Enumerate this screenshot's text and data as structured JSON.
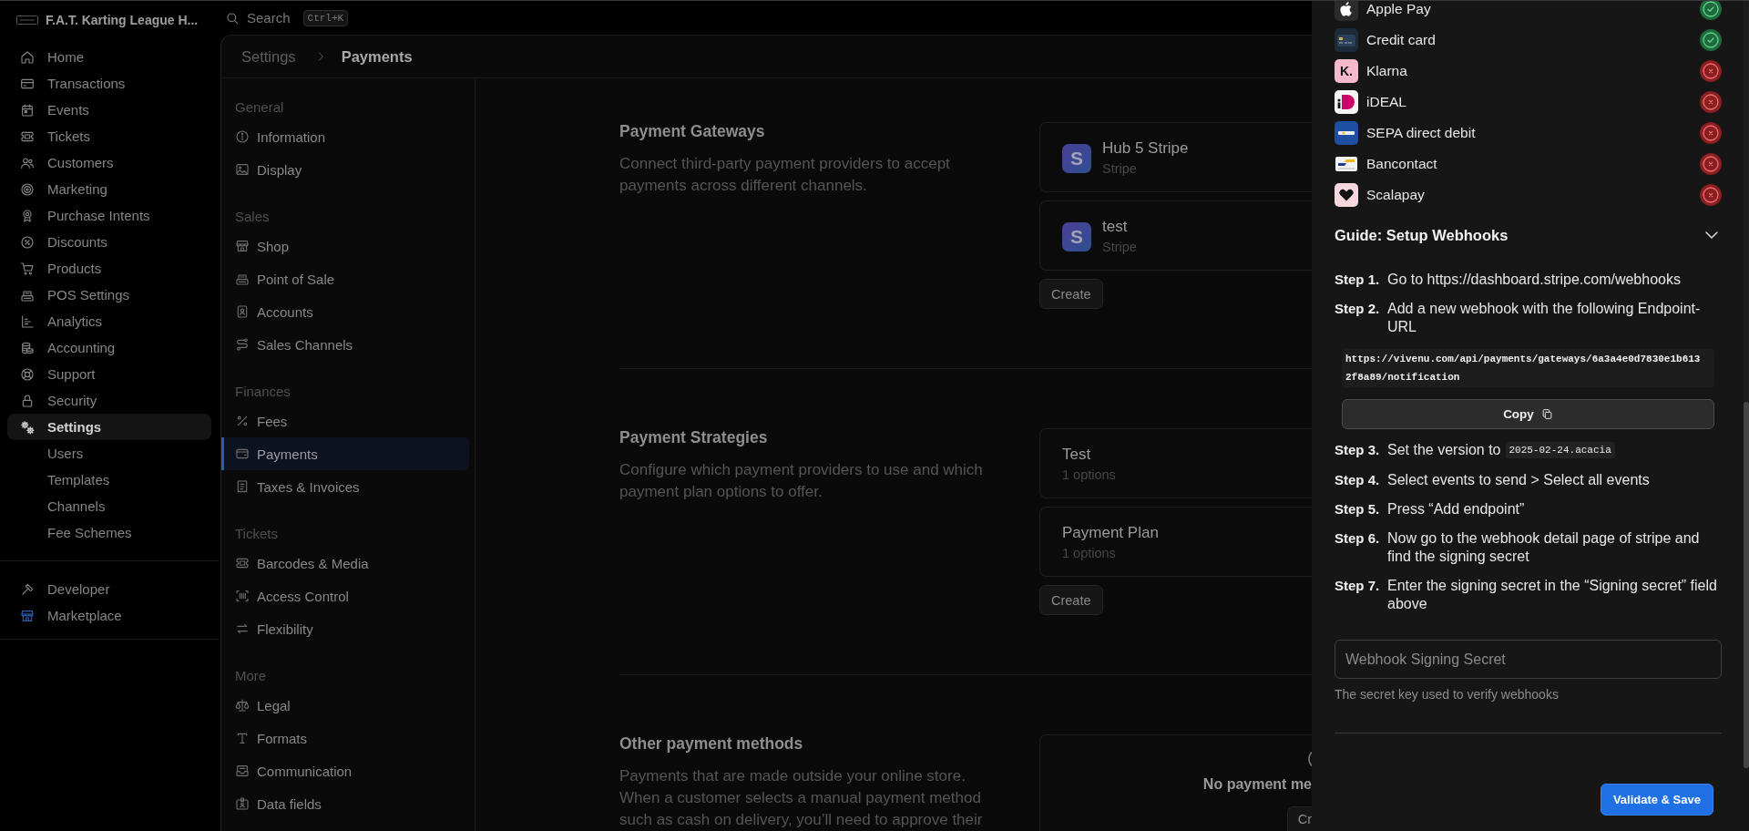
{
  "sidebar": {
    "org_name": "F.A.T. Karting League H...",
    "items": [
      {
        "label": "Home",
        "selected": false
      },
      {
        "label": "Transactions",
        "selected": false
      },
      {
        "label": "Events",
        "selected": false
      },
      {
        "label": "Tickets",
        "selected": false
      },
      {
        "label": "Customers",
        "selected": false
      },
      {
        "label": "Marketing",
        "selected": false
      },
      {
        "label": "Purchase Intents",
        "selected": false
      },
      {
        "label": "Discounts",
        "selected": false
      },
      {
        "label": "Products",
        "selected": false
      },
      {
        "label": "POS Settings",
        "selected": false
      },
      {
        "label": "Analytics",
        "selected": false
      },
      {
        "label": "Accounting",
        "selected": false
      },
      {
        "label": "Support",
        "selected": false
      },
      {
        "label": "Security",
        "selected": false
      },
      {
        "label": "Settings",
        "selected": true,
        "children": [
          {
            "label": "Users",
            "selected": false
          },
          {
            "label": "Templates",
            "selected": false
          },
          {
            "label": "Channels",
            "selected": false
          },
          {
            "label": "Fee Schemes",
            "selected": false
          }
        ]
      }
    ],
    "footer_items": [
      {
        "label": "Developer",
        "selected": false
      },
      {
        "label": "Marketplace",
        "selected": false
      }
    ]
  },
  "search": {
    "label": "Search",
    "shortcut": "Ctrl+K"
  },
  "breadcrumb": [
    "Settings",
    "Payments"
  ],
  "settings_nav": {
    "groups": [
      {
        "title": "General",
        "items": [
          {
            "label": "Information",
            "selected": false
          },
          {
            "label": "Display",
            "selected": false
          }
        ]
      },
      {
        "title": "Sales",
        "items": [
          {
            "label": "Shop",
            "selected": false
          },
          {
            "label": "Point of Sale",
            "selected": false
          },
          {
            "label": "Accounts",
            "selected": false
          },
          {
            "label": "Sales Channels",
            "selected": false
          }
        ]
      },
      {
        "title": "Finances",
        "items": [
          {
            "label": "Fees",
            "selected": false
          },
          {
            "label": "Payments",
            "selected": true
          },
          {
            "label": "Taxes & Invoices",
            "selected": false
          }
        ]
      },
      {
        "title": "Tickets",
        "items": [
          {
            "label": "Barcodes & Media",
            "selected": false
          },
          {
            "label": "Access Control",
            "selected": false
          },
          {
            "label": "Flexibility",
            "selected": false
          }
        ]
      },
      {
        "title": "More",
        "items": [
          {
            "label": "Legal",
            "selected": false
          },
          {
            "label": "Formats",
            "selected": false
          },
          {
            "label": "Communication",
            "selected": false
          },
          {
            "label": "Data fields",
            "selected": false
          }
        ]
      }
    ]
  },
  "sections": [
    {
      "kind": "gateways",
      "title": "Payment Gateways",
      "description": "Connect third-party payment providers to accept payments across different channels.",
      "cards": [
        {
          "logo": "S",
          "title": "Hub 5 Stripe",
          "subtitle": "Stripe"
        },
        {
          "logo": "S",
          "title": "test",
          "subtitle": "Stripe"
        }
      ],
      "button": "Create"
    },
    {
      "kind": "strategies",
      "title": "Payment Strategies",
      "description": "Configure which payment providers to use and which payment plan options to offer.",
      "cards": [
        {
          "title": "Test",
          "subtitle": "1 options"
        },
        {
          "title": "Payment Plan",
          "subtitle": "1 options"
        }
      ],
      "button": "Create"
    },
    {
      "kind": "other",
      "title": "Other payment methods",
      "description": "Payments that are made outside your online store. When a customer selects a manual payment method such as cash on delivery, you’ll need to approve their",
      "empty_state": {
        "title": "No payment me",
        "button": "Cr"
      }
    }
  ],
  "drawer": {
    "payment_methods": [
      {
        "name": "Apple Pay",
        "enabled": true
      },
      {
        "name": "Credit card",
        "enabled": true
      },
      {
        "name": "Klarna",
        "logo": "K.",
        "enabled": false
      },
      {
        "name": "iDEAL",
        "enabled": false
      },
      {
        "name": "SEPA direct debit",
        "enabled": false
      },
      {
        "name": "Bancontact",
        "enabled": false
      },
      {
        "name": "Scalapay",
        "enabled": false
      }
    ],
    "guide": {
      "title": "Guide: Setup Webhooks",
      "expanded": true,
      "steps": [
        {
          "label": "Step 1.",
          "text": "Go to https://dashboard.stripe.com/webhooks"
        },
        {
          "label": "Step 2.",
          "text": "Add a new webhook with the following Endpoint-URL",
          "endpoint_url": "https://vivenu.com/api/payments/gateways/6a3a4e0d7830e1b6132f8a89/notification",
          "copy_button": "Copy"
        },
        {
          "label": "Step 3.",
          "text": "Set the version to",
          "code": "2025-02-24.acacia"
        },
        {
          "label": "Step 4.",
          "text": "Select events to send > Select all events"
        },
        {
          "label": "Step 5.",
          "text": "Press “Add endpoint”"
        },
        {
          "label": "Step 6.",
          "text": "Now go to the webhook detail page of stripe and find the signing secret"
        },
        {
          "label": "Step 7.",
          "text": "Enter the signing secret in the “Signing secret” field above"
        }
      ]
    },
    "secret_field": {
      "placeholder": "Webhook Signing Secret",
      "hint": "The secret key used to verify webhooks"
    },
    "submit_button": "Validate & Save"
  }
}
